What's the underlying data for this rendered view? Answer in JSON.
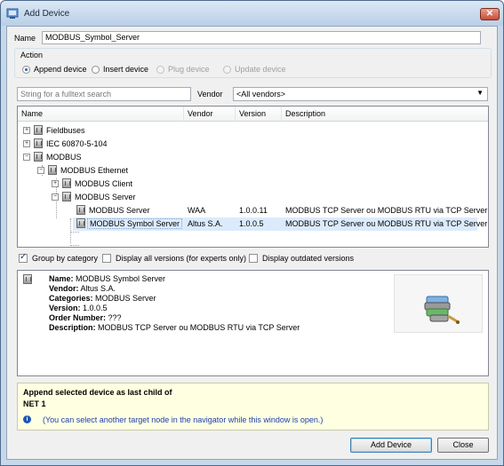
{
  "window": {
    "title": "Add Device",
    "close_glyph": "✕"
  },
  "name_field": {
    "label": "Name",
    "value": "MODBUS_Symbol_Server"
  },
  "action": {
    "label": "Action",
    "options": [
      {
        "label": "Append device",
        "selected": true,
        "enabled": true
      },
      {
        "label": "Insert device",
        "selected": false,
        "enabled": true
      },
      {
        "label": "Plug device",
        "selected": false,
        "enabled": false
      },
      {
        "label": "Update device",
        "selected": false,
        "enabled": false
      }
    ]
  },
  "search": {
    "placeholder": "String for a fulltext search"
  },
  "vendor_filter": {
    "label": "Vendor",
    "value": "<All vendors>",
    "arrow_icon": "dropdown-arrow-icon"
  },
  "tree": {
    "columns": [
      "Name",
      "Vendor",
      "Version",
      "Description"
    ],
    "rows": [
      {
        "name": "Fieldbuses",
        "vendor": "",
        "version": "",
        "description": "",
        "expander": "+"
      },
      {
        "name": "IEC 60870-5-104",
        "vendor": "",
        "version": "",
        "description": "",
        "expander": "+"
      },
      {
        "name": "MODBUS",
        "vendor": "",
        "version": "",
        "description": "",
        "expander": "−"
      },
      {
        "name": "MODBUS Ethernet",
        "vendor": "",
        "version": "",
        "description": "",
        "expander": "−"
      },
      {
        "name": "MODBUS Client",
        "vendor": "",
        "version": "",
        "description": "",
        "expander": "+"
      },
      {
        "name": "MODBUS Server",
        "vendor": "",
        "version": "",
        "description": "",
        "expander": "−"
      },
      {
        "name": "MODBUS Server",
        "vendor": "WAA",
        "version": "1.0.0.11",
        "description": "MODBUS TCP Server ou MODBUS RTU via TCP Server",
        "expander": ""
      },
      {
        "name": "MODBUS Symbol Server",
        "vendor": "Altus S.A.",
        "version": "1.0.0.5",
        "description": "MODBUS TCP Server ou MODBUS RTU via TCP Server",
        "expander": "",
        "selected": true
      }
    ]
  },
  "options": {
    "group_by_category": {
      "label": "Group by category",
      "checked": true
    },
    "display_all_versions": {
      "label": "Display all versions (for experts only)",
      "checked": false
    },
    "display_outdated": {
      "label": "Display outdated versions",
      "checked": false
    }
  },
  "info": {
    "name_label": "Name:",
    "name_value": "MODBUS Symbol Server",
    "vendor_label": "Vendor:",
    "vendor_value": "Altus S.A.",
    "categories_label": "Categories:",
    "categories_value": "MODBUS Server",
    "version_label": "Version:",
    "version_value": "1.0.0.5",
    "order_label": "Order Number:",
    "order_value": "???",
    "description_label": "Description:",
    "description_value": "MODBUS TCP Server ou MODBUS RTU via TCP Server",
    "image_icon": "modbus-device-image"
  },
  "hint": {
    "line1": "Append selected device as last child of",
    "line2": "NET 1",
    "note": "(You can select another target node in the navigator while this window is open.)",
    "icon_glyph": "i"
  },
  "buttons": {
    "add": "Add Device",
    "close": "Close"
  },
  "colors": {
    "selection": "#dcebfc",
    "hint_background": "#ffffe1",
    "hint_text": "#1c3fb0"
  }
}
